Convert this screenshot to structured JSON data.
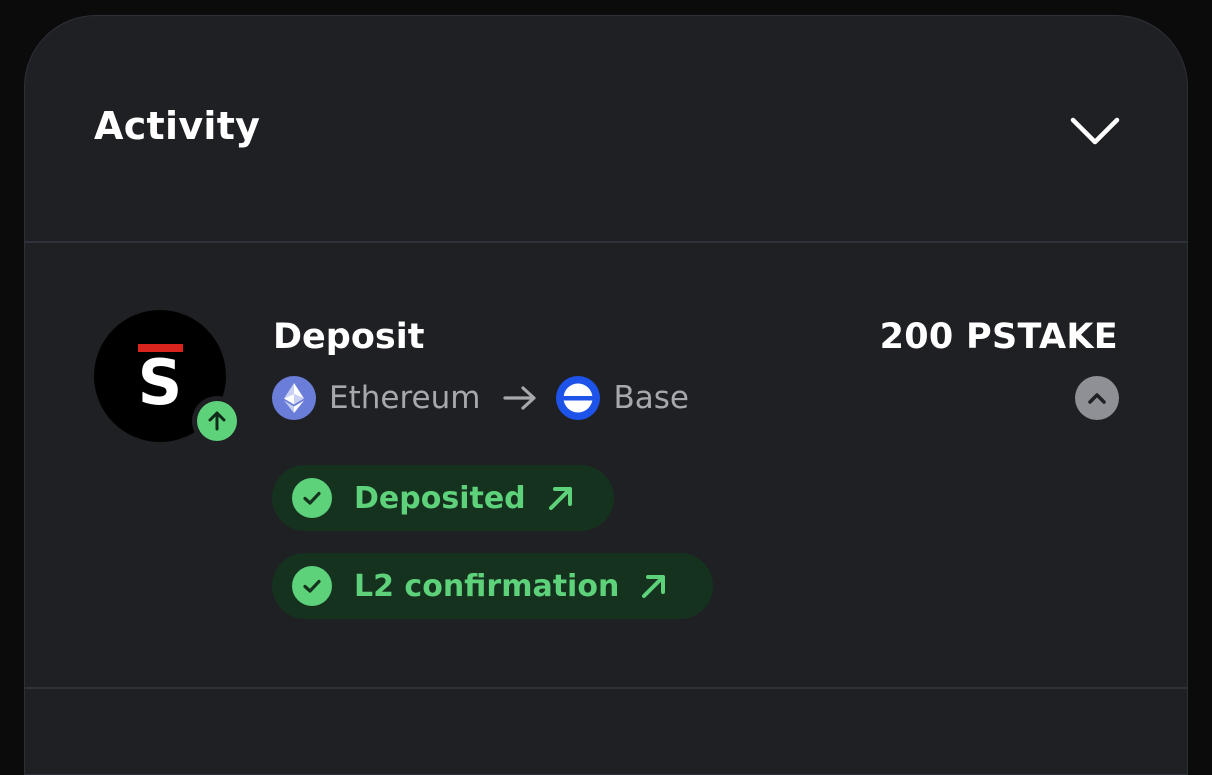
{
  "header": {
    "title": "Activity",
    "collapse_icon": "chevron-down-icon"
  },
  "transaction": {
    "avatar_letter": "S",
    "type": "Deposit",
    "amount": "200 PSTAKE",
    "direction_icon": "arrow-up-icon",
    "from_chain": "Ethereum",
    "to_chain": "Base",
    "expand_icon": "chevron-up-icon",
    "statuses": [
      {
        "label": "Deposited",
        "icon": "check-circle-icon",
        "link_icon": "external-arrow-icon"
      },
      {
        "label": "L2 confirmation",
        "icon": "check-circle-icon",
        "link_icon": "external-arrow-icon"
      }
    ]
  },
  "colors": {
    "panel_bg": "#1f2024",
    "success": "#5ed27a",
    "success_bg": "#15321f",
    "muted_text": "#a6a8ae",
    "ethereum": "#6a7dd8",
    "base": "#1e53ea",
    "brand_red": "#d8241c"
  }
}
